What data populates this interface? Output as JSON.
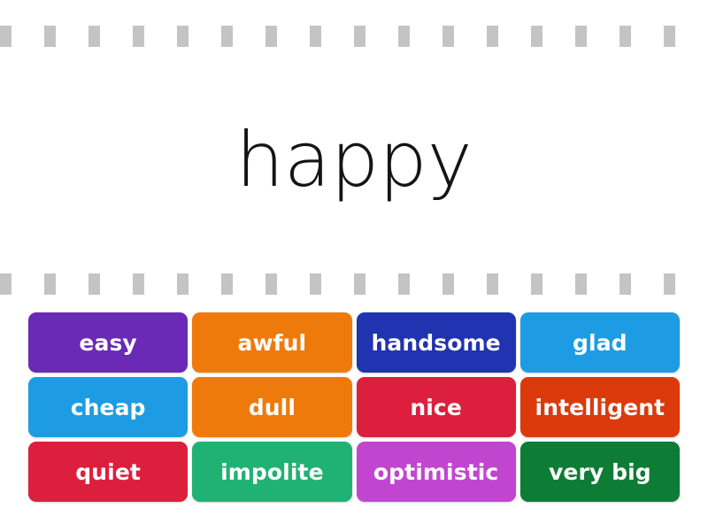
{
  "activity": {
    "prompt_word": "happy",
    "separator": {
      "dash_count": 20,
      "dash_color": "#c4c4c4"
    }
  },
  "tiles": {
    "rows": [
      [
        {
          "label": "easy",
          "color": "#6a2ab5"
        },
        {
          "label": "awful",
          "color": "#ef7a0c"
        },
        {
          "label": "handsome",
          "color": "#2033b0"
        },
        {
          "label": "glad",
          "color": "#1e9ce3"
        }
      ],
      [
        {
          "label": "cheap",
          "color": "#1e9ce3"
        },
        {
          "label": "dull",
          "color": "#ef7a0c"
        },
        {
          "label": "nice",
          "color": "#dc1f3c"
        },
        {
          "label": "intelligent",
          "color": "#dc3a0c"
        }
      ],
      [
        {
          "label": "quiet",
          "color": "#dc1f3c"
        },
        {
          "label": "impolite",
          "color": "#20b272"
        },
        {
          "label": "optimistic",
          "color": "#c245d0"
        },
        {
          "label": "very big",
          "color": "#0d7c35"
        }
      ]
    ]
  }
}
